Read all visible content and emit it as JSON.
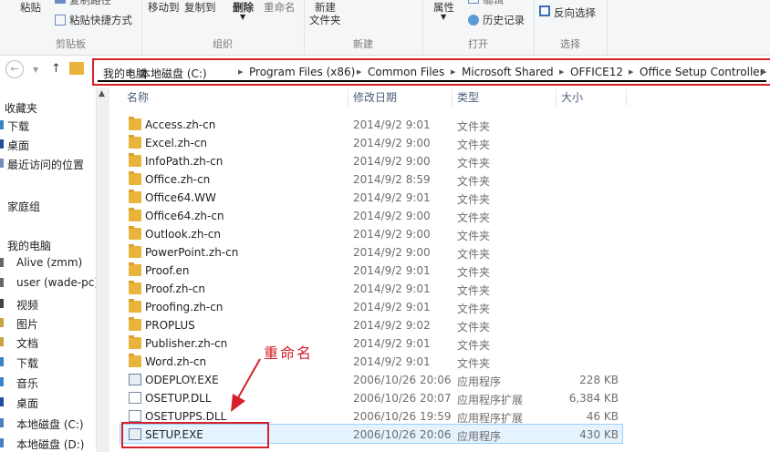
{
  "ribbon": {
    "clipboard": {
      "paste_label": "粘贴",
      "copy_path_label": "复制路径",
      "paste_shortcut_label": "粘贴快捷方式",
      "group_label": "剪贴板"
    },
    "organize": {
      "move_to_label": "移动到",
      "copy_to_label": "复制到",
      "delete_label": "删除",
      "rename_label": "重命名",
      "group_label": "组织"
    },
    "new": {
      "new_label": "新建",
      "folder_label": "文件夹",
      "group_label": "新建"
    },
    "open": {
      "properties_label": "属性",
      "edit_label": "编辑",
      "history_label": "历史记录",
      "group_label": "打开"
    },
    "select": {
      "invert_label": "反向选择",
      "group_label": "选择"
    }
  },
  "breadcrumb": [
    "我的电脑",
    "本地磁盘 (C:)",
    "Program Files (x86)",
    "Common Files",
    "Microsoft Shared",
    "OFFICE12",
    "Office Setup Controller"
  ],
  "sidebar": {
    "favorites_label": "收藏夹",
    "favorites": [
      "下载",
      "桌面",
      "最近访问的位置"
    ],
    "homegroup_label": "家庭组",
    "computer_label": "我的电脑",
    "computer": [
      "Alive (zmm)",
      "user (wade-pc)",
      "视频",
      "图片",
      "文档",
      "下载",
      "音乐",
      "桌面",
      "本地磁盘 (C:)",
      "本地磁盘 (D:)"
    ]
  },
  "columns": {
    "name": "名称",
    "date": "修改日期",
    "type": "类型",
    "size": "大小"
  },
  "files": [
    {
      "name": "Access.zh-cn",
      "date": "2014/9/2 9:01",
      "type": "文件夹",
      "size": "",
      "kind": "folder"
    },
    {
      "name": "Excel.zh-cn",
      "date": "2014/9/2 9:00",
      "type": "文件夹",
      "size": "",
      "kind": "folder"
    },
    {
      "name": "InfoPath.zh-cn",
      "date": "2014/9/2 9:00",
      "type": "文件夹",
      "size": "",
      "kind": "folder"
    },
    {
      "name": "Office.zh-cn",
      "date": "2014/9/2 8:59",
      "type": "文件夹",
      "size": "",
      "kind": "folder"
    },
    {
      "name": "Office64.WW",
      "date": "2014/9/2 9:01",
      "type": "文件夹",
      "size": "",
      "kind": "folder"
    },
    {
      "name": "Office64.zh-cn",
      "date": "2014/9/2 9:00",
      "type": "文件夹",
      "size": "",
      "kind": "folder"
    },
    {
      "name": "Outlook.zh-cn",
      "date": "2014/9/2 9:00",
      "type": "文件夹",
      "size": "",
      "kind": "folder"
    },
    {
      "name": "PowerPoint.zh-cn",
      "date": "2014/9/2 9:00",
      "type": "文件夹",
      "size": "",
      "kind": "folder"
    },
    {
      "name": "Proof.en",
      "date": "2014/9/2 9:01",
      "type": "文件夹",
      "size": "",
      "kind": "folder"
    },
    {
      "name": "Proof.zh-cn",
      "date": "2014/9/2 9:01",
      "type": "文件夹",
      "size": "",
      "kind": "folder"
    },
    {
      "name": "Proofing.zh-cn",
      "date": "2014/9/2 9:01",
      "type": "文件夹",
      "size": "",
      "kind": "folder"
    },
    {
      "name": "PROPLUS",
      "date": "2014/9/2 9:02",
      "type": "文件夹",
      "size": "",
      "kind": "folder"
    },
    {
      "name": "Publisher.zh-cn",
      "date": "2014/9/2 9:01",
      "type": "文件夹",
      "size": "",
      "kind": "folder"
    },
    {
      "name": "Word.zh-cn",
      "date": "2014/9/2 9:01",
      "type": "文件夹",
      "size": "",
      "kind": "folder"
    },
    {
      "name": "ODEPLOY.EXE",
      "date": "2006/10/26 20:06",
      "type": "应用程序",
      "size": "228 KB",
      "kind": "exe"
    },
    {
      "name": "OSETUP.DLL",
      "date": "2006/10/26 20:07",
      "type": "应用程序扩展",
      "size": "6,384 KB",
      "kind": "dll"
    },
    {
      "name": "OSETUPPS.DLL",
      "date": "2006/10/26 19:59",
      "type": "应用程序扩展",
      "size": "46 KB",
      "kind": "dll"
    },
    {
      "name": "SETUP.EXE",
      "date": "2006/10/26 20:06",
      "type": "应用程序",
      "size": "430 KB",
      "kind": "exe"
    }
  ],
  "annotation": "重命名",
  "colors": {
    "highlight": "#d8202a",
    "selection": "#e5f3ff",
    "folder": "#e8b43c"
  }
}
